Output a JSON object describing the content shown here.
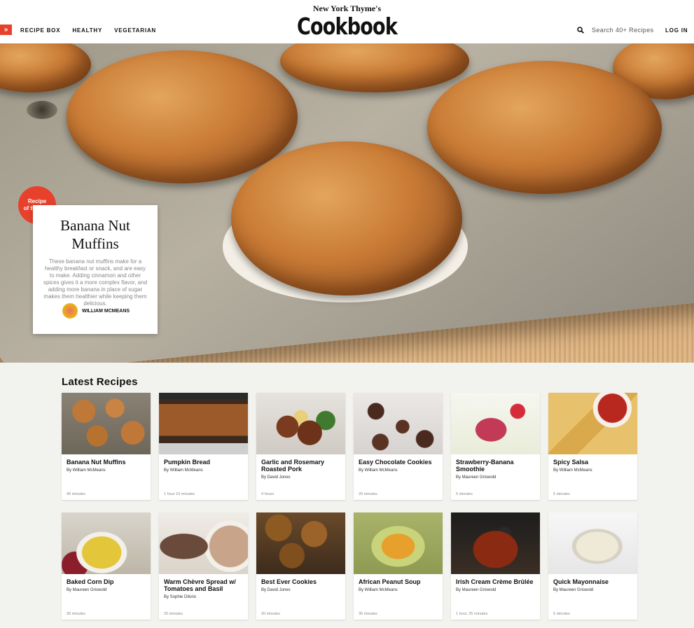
{
  "header": {
    "menu_icon": "double-chevron-right-icon",
    "nav": [
      "RECIPE BOX",
      "HEALTHY",
      "VEGETARIAN"
    ],
    "brand_top": "New York Thyme's",
    "brand_main": "Cookbook",
    "search_icon": "search-icon",
    "search_placeholder": "Search 40+ Recipes",
    "login": "LOG IN"
  },
  "hero": {
    "badge": [
      "Recipe",
      "of the Day"
    ],
    "title": "Banana Nut Muffins",
    "description": "These banana nut muffins make for a healthy breakfast or snack, and are easy to make. Adding cinnamon and other spices gives it a more complex flavor, and adding more banana in place of sugar makes them healthier while keeping them delicious.",
    "author": "WILLIAM MCMEANS"
  },
  "latest": {
    "title": "Latest Recipes",
    "cards": [
      {
        "title": "Banana Nut Muffins",
        "author": "By William McMeans",
        "time": "40 minutes"
      },
      {
        "title": "Pumpkin Bread",
        "author": "By William McMeans",
        "time": "1 hour 10 minutes"
      },
      {
        "title": "Garlic and Rosemary Roasted Pork",
        "author": "By David Jones",
        "time": "4 hours"
      },
      {
        "title": "Easy Chocolate Cookies",
        "author": "By William McMeans",
        "time": "20 minutes"
      },
      {
        "title": "Strawberry-Banana Smoothie",
        "author": "By Maureen Griswold",
        "time": "5 minutes"
      },
      {
        "title": "Spicy Salsa",
        "author": "By William McMeans",
        "time": "5 minutes"
      },
      {
        "title": "Baked Corn Dip",
        "author": "By Maureen Griswold",
        "time": "30 minutes"
      },
      {
        "title": "Warm Chèvre Spread w/ Tomatoes and Basil",
        "author": "By Sophie Dilorio",
        "time": "20 minutes"
      },
      {
        "title": "Best Ever Cookies",
        "author": "By David Jones",
        "time": "20 minutes"
      },
      {
        "title": "African Peanut Soup",
        "author": "By William McMeans",
        "time": "30 minutes"
      },
      {
        "title": "Irish Cream Crème Brûlée",
        "author": "By Maureen Griswold",
        "time": "1 hour, 25 minutes"
      },
      {
        "title": "Quick Mayonnaise",
        "author": "By Maureen Griswold",
        "time": "5 minutes"
      }
    ]
  },
  "colors": {
    "accent": "#e8412b",
    "background": "#f2f2ee"
  }
}
